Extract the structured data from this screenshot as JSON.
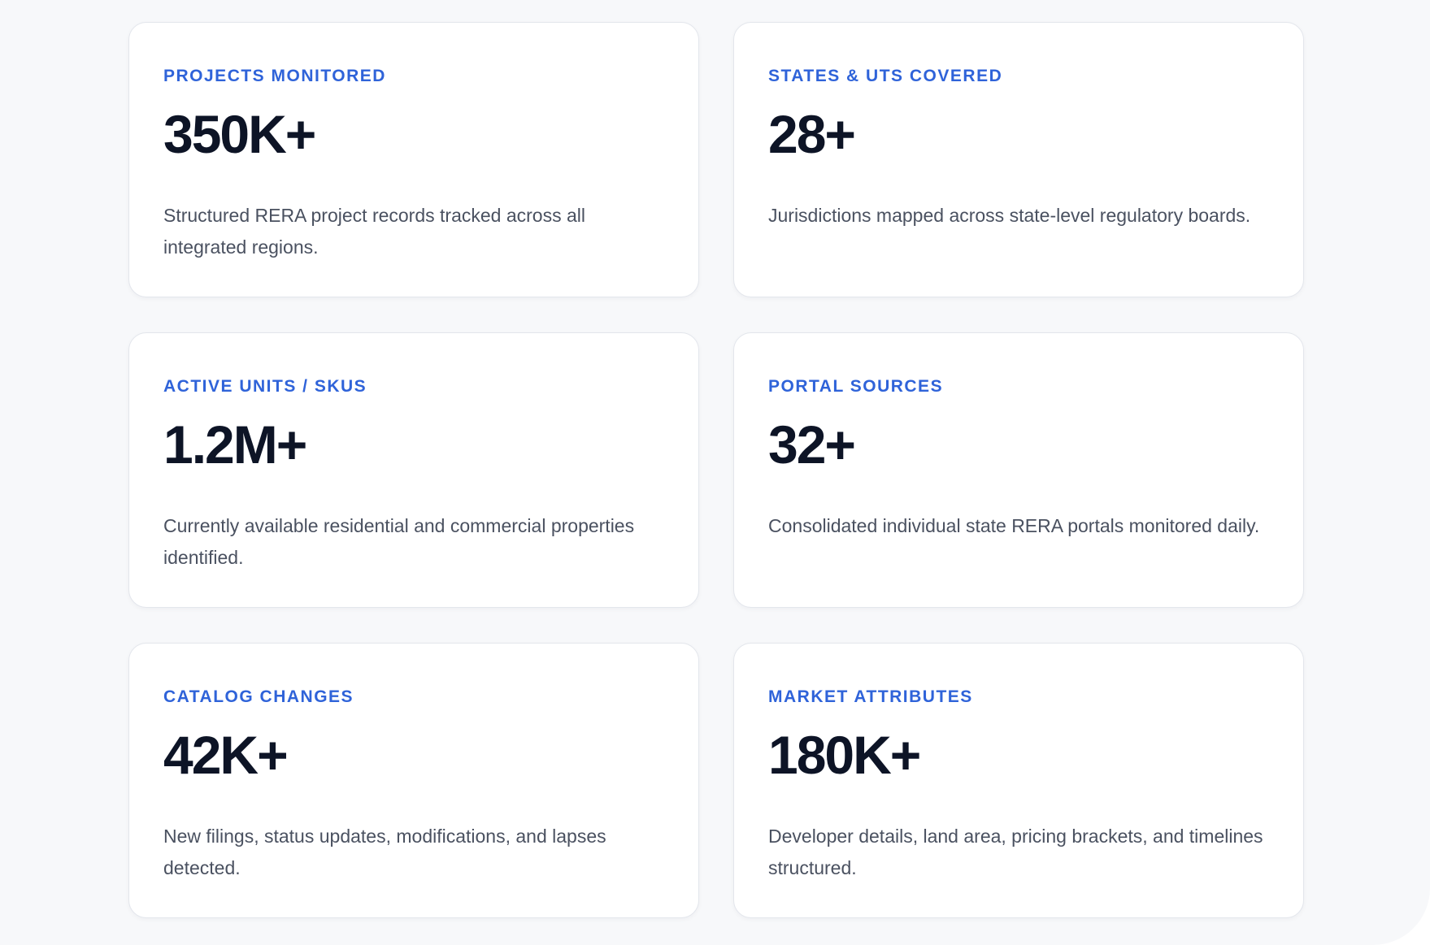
{
  "stats": [
    {
      "label": "PROJECTS MONITORED",
      "value": "350K+",
      "description": "Structured RERA project records tracked across all integrated regions."
    },
    {
      "label": "STATES & UTS COVERED",
      "value": "28+",
      "description": "Jurisdictions mapped across state-level regulatory boards."
    },
    {
      "label": "ACTIVE UNITS / SKUS",
      "value": "1.2M+",
      "description": "Currently available residential and commercial properties identified."
    },
    {
      "label": "PORTAL SOURCES",
      "value": "32+",
      "description": "Consolidated individual state RERA portals monitored daily."
    },
    {
      "label": "CATALOG CHANGES",
      "value": "42K+",
      "description": "New filings, status updates, modifications, and lapses detected."
    },
    {
      "label": "MARKET ATTRIBUTES",
      "value": "180K+",
      "description": "Developer details, land area, pricing brackets, and timelines structured."
    }
  ],
  "colors": {
    "label_accent": "#2f63d9",
    "value_text": "#0d1426",
    "description_text": "#4a5160",
    "card_background": "#ffffff",
    "page_background": "#f7f8fa"
  }
}
